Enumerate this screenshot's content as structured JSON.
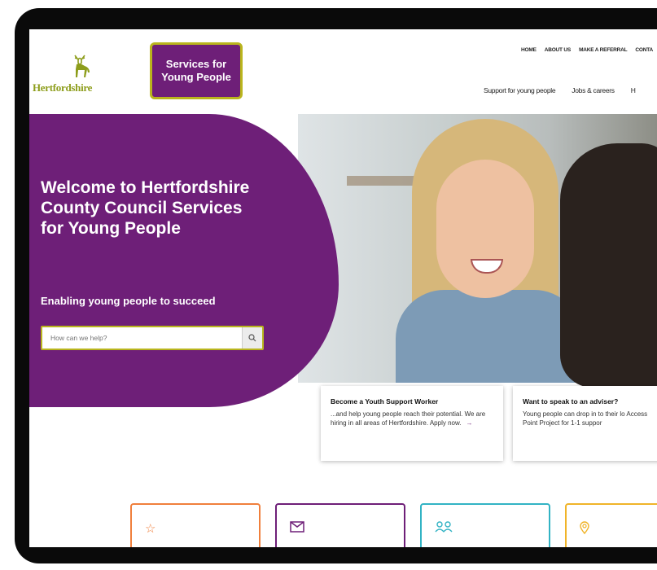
{
  "header": {
    "logo_text": "Hertfordshire",
    "badge_label": "Services for Young People",
    "top_nav": [
      "HOME",
      "ABOUT US",
      "MAKE A REFERRAL",
      "CONTA"
    ],
    "main_nav": [
      "Support for young people",
      "Jobs & careers",
      "H"
    ]
  },
  "hero": {
    "title": "Welcome to Hertfordshire County Council Services for Young People",
    "subtitle": "Enabling young people to succeed",
    "search_placeholder": "How can we help?"
  },
  "cards": [
    {
      "title": "Become a Youth Support Worker",
      "body": "...and help young people reach their potential. We are hiring in all areas of Hertfordshire. Apply now.",
      "arrow": "→"
    },
    {
      "title": "Want to speak to an adviser?",
      "body": "Young people can drop in to their lo Access Point Project for 1-1 suppor"
    }
  ],
  "tiles": [
    {
      "icon": "star-icon",
      "color": "#f07f3c"
    },
    {
      "icon": "mail-icon",
      "color": "#6e1f78"
    },
    {
      "icon": "people-icon",
      "color": "#32b3c4"
    },
    {
      "icon": "location-pin-icon",
      "color": "#f0b429"
    }
  ],
  "colors": {
    "brand_purple": "#6e1f78",
    "accent_olive": "#b9b51d",
    "logo_green": "#8d9d1b"
  }
}
